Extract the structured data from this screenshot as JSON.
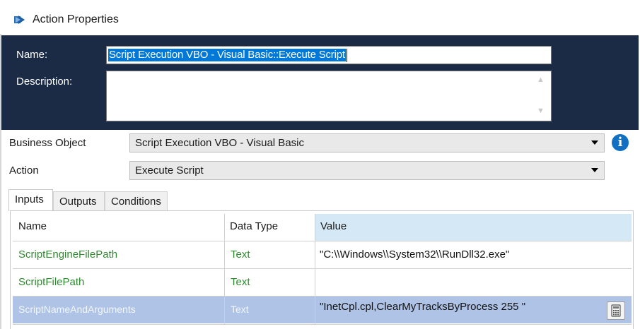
{
  "window": {
    "title": "Action Properties",
    "icon": "blueprism-app-icon"
  },
  "header": {
    "name_label": "Name:",
    "name_value": "Script Execution VBO - Visual Basic::Execute Script",
    "description_label": "Description:",
    "description_value": ""
  },
  "fields": {
    "business_object_label": "Business Object",
    "business_object_value": "Script Execution VBO - Visual Basic",
    "action_label": "Action",
    "action_value": "Execute Script"
  },
  "tabs": [
    {
      "label": "Inputs",
      "active": true
    },
    {
      "label": "Outputs",
      "active": false
    },
    {
      "label": "Conditions",
      "active": false
    }
  ],
  "grid": {
    "columns": [
      "Name",
      "Data Type",
      "Value"
    ],
    "rows": [
      {
        "name": "ScriptEngineFilePath",
        "type": "Text",
        "value": "\"C:\\\\Windows\\\\System32\\\\RunDll32.exe\""
      },
      {
        "name": "ScriptFilePath",
        "type": "Text",
        "value": ""
      },
      {
        "name": "ScriptNameAndArguments",
        "type": "Text",
        "value": "\"InetCpl.cpl,ClearMyTracksByProcess 255 \""
      }
    ]
  },
  "colors": {
    "header_bg": "#1b2b45",
    "selection": "#0078d7",
    "row_selected": "#aec3e6",
    "name_green": "#2f8a2f",
    "info_blue": "#1170c1"
  }
}
